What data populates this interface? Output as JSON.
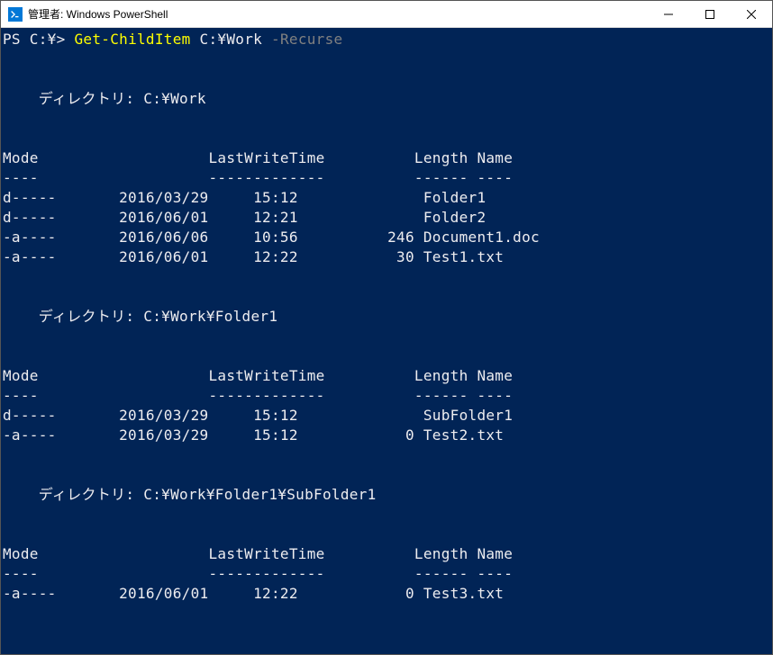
{
  "window": {
    "title": "管理者: Windows PowerShell"
  },
  "prompt": {
    "ps": "PS C:\\> ",
    "cmd": "Get-ChildItem",
    "arg": " C:\\Work ",
    "flag": "-Recurse"
  },
  "dir_label": "ディレクトリ:",
  "headers": {
    "mode": "Mode",
    "lastwrite": "LastWriteTime",
    "length": "Length",
    "name": "Name"
  },
  "dashes": {
    "mode": "----",
    "lastwrite": "-------------",
    "length": "------",
    "name": "----"
  },
  "listings": [
    {
      "path": "C:\\Work",
      "rows": [
        {
          "mode": "d-----",
          "date": "2016/03/29",
          "time": "15:12",
          "length": "",
          "name": "Folder1"
        },
        {
          "mode": "d-----",
          "date": "2016/06/01",
          "time": "12:21",
          "length": "",
          "name": "Folder2"
        },
        {
          "mode": "-a----",
          "date": "2016/06/06",
          "time": "10:56",
          "length": "246",
          "name": "Document1.doc"
        },
        {
          "mode": "-a----",
          "date": "2016/06/01",
          "time": "12:22",
          "length": "30",
          "name": "Test1.txt"
        }
      ]
    },
    {
      "path": "C:\\Work\\Folder1",
      "rows": [
        {
          "mode": "d-----",
          "date": "2016/03/29",
          "time": "15:12",
          "length": "",
          "name": "SubFolder1"
        },
        {
          "mode": "-a----",
          "date": "2016/03/29",
          "time": "15:12",
          "length": "0",
          "name": "Test2.txt"
        }
      ]
    },
    {
      "path": "C:\\Work\\Folder1\\SubFolder1",
      "rows": [
        {
          "mode": "-a----",
          "date": "2016/06/01",
          "time": "12:22",
          "length": "0",
          "name": "Test3.txt"
        }
      ]
    }
  ]
}
